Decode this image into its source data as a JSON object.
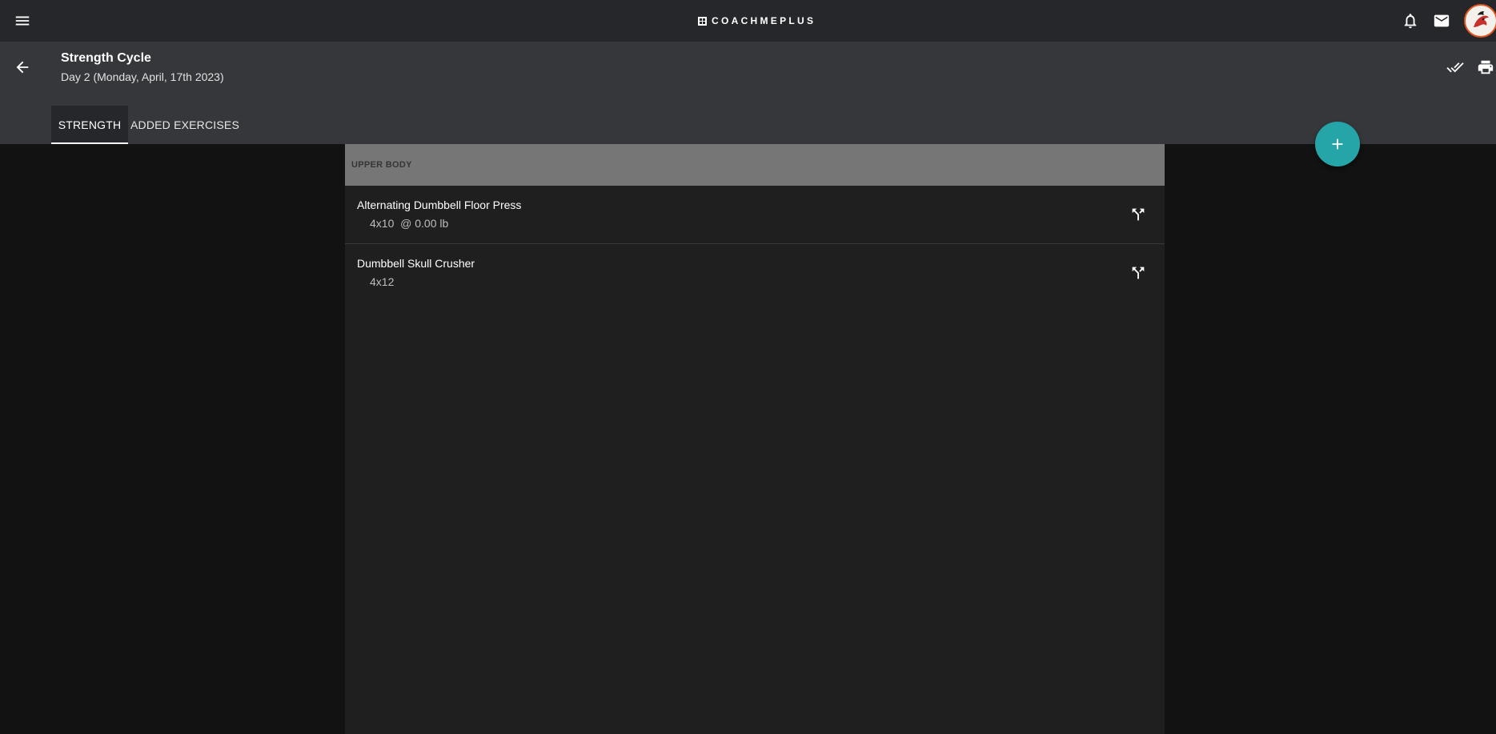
{
  "topbar": {
    "logo_text": "COACHMEPLUS",
    "icons": {
      "menu": "menu-icon",
      "notifications": "bell-icon",
      "messages": "mail-icon",
      "avatar": "avatar"
    }
  },
  "header": {
    "title": "Strength Cycle",
    "subtitle": "Day 2 (Monday, April, 17th 2023)",
    "icons": {
      "back": "arrow-left-icon",
      "mark_complete": "double-check-icon",
      "print": "printer-icon"
    }
  },
  "tabs": [
    {
      "label": "STRENGTH",
      "active": true
    },
    {
      "label": "ADDED EXERCISES",
      "active": false
    }
  ],
  "fab": {
    "icon": "plus-icon"
  },
  "group": {
    "label": "UPPER BODY",
    "exercises": [
      {
        "name": "Alternating Dumbbell Floor Press",
        "detail": "4x10  @ 0.00 lb",
        "action_icon": "fork-arrows-icon"
      },
      {
        "name": "Dumbbell Skull Crusher",
        "detail": "4x12",
        "action_icon": "fork-arrows-icon"
      }
    ]
  },
  "colors": {
    "topbar_bg": "#25272b",
    "subheader_bg": "#35373b",
    "page_bg": "#121212",
    "content_bg": "#1f1f1f",
    "group_header_bg": "#767676",
    "fab_accent": "#26a5a9",
    "avatar_ring": "#e0551f"
  }
}
